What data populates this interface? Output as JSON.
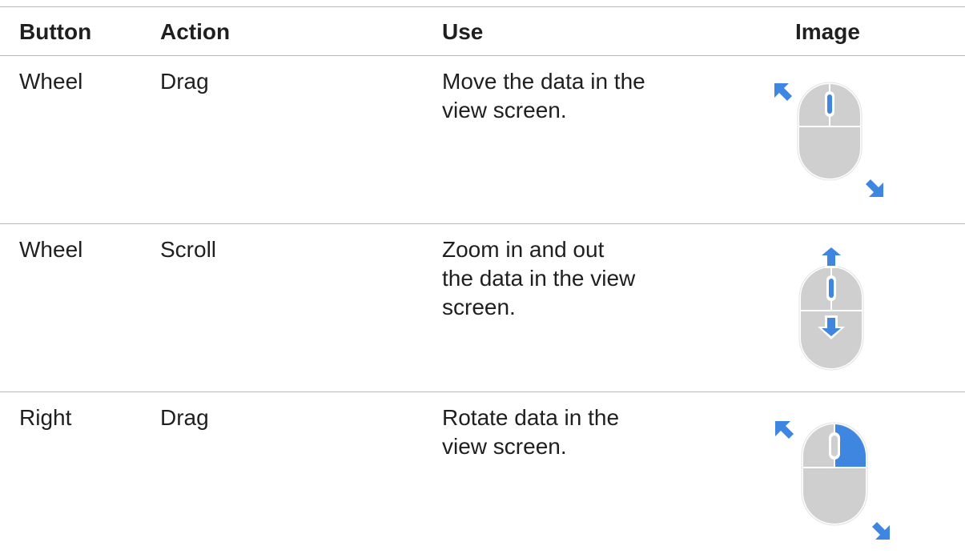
{
  "table": {
    "headers": {
      "button": "Button",
      "action": "Action",
      "use": "Use",
      "image": "Image"
    },
    "rows": [
      {
        "button": "Wheel",
        "action": "Drag",
        "use": "Move the data in the\nview screen.",
        "image_icon": "mouse-wheel-drag-icon"
      },
      {
        "button": "Wheel",
        "action": "Scroll",
        "use": "Zoom in and out\nthe data in the view\nscreen.",
        "image_icon": "mouse-wheel-scroll-icon"
      },
      {
        "button": "Right",
        "action": "Drag",
        "use": "Rotate data in the\nview screen.",
        "image_icon": "mouse-right-drag-icon"
      }
    ]
  },
  "colors": {
    "rule": "#b9b9b9",
    "mouse_body": "#cfcfcf",
    "mouse_outline": "#ffffff",
    "accent_blue": "#3f86e0"
  }
}
